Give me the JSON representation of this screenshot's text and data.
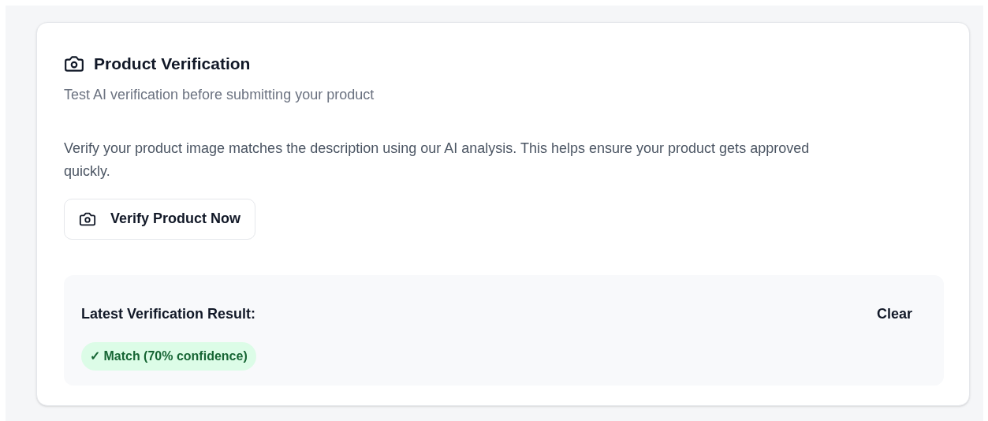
{
  "card": {
    "title": "Product Verification",
    "subtitle": "Test AI verification before submitting your product"
  },
  "description": "Verify your product image matches the description using our AI analysis. This helps ensure your product gets approved quickly.",
  "verify_button": {
    "label": "Verify Product Now"
  },
  "result": {
    "heading": "Latest Verification Result:",
    "clear_label": "Clear",
    "badge": {
      "matched": true,
      "label": "✓ Match (70% confidence)"
    }
  }
}
